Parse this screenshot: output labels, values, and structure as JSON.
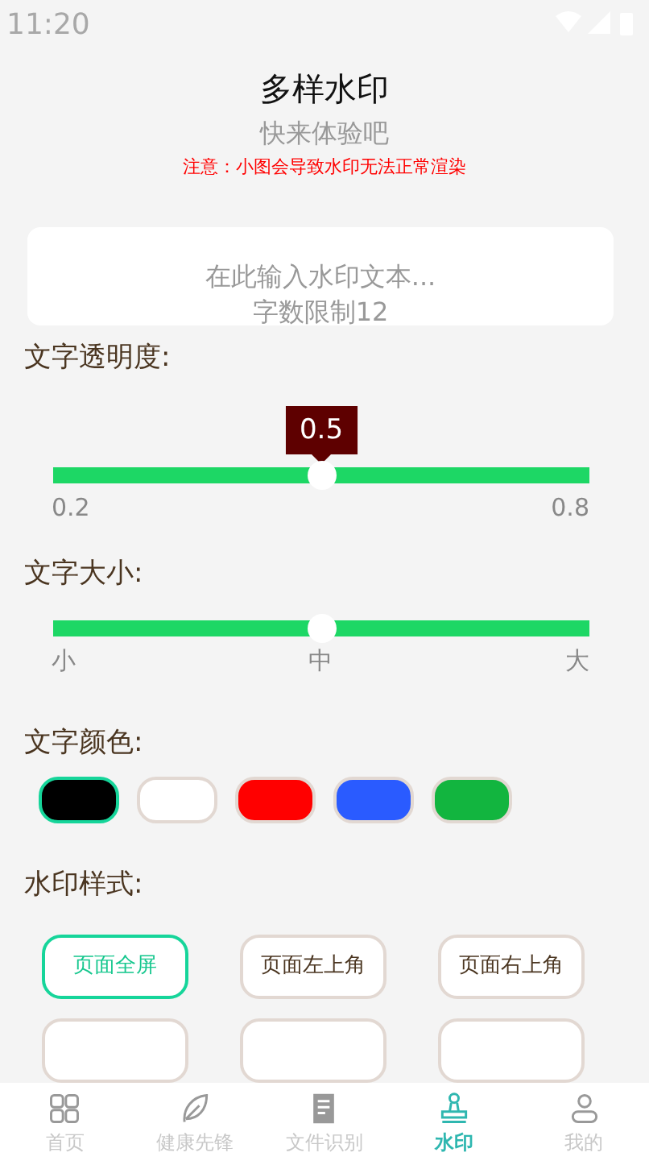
{
  "status_bar": {
    "time": "11:20"
  },
  "header": {
    "title": "多样水印",
    "subtitle": "快来体验吧",
    "notice": "注意：小图会导致水印无法正常渲染"
  },
  "text_input": {
    "placeholder": "在此输入水印文本...\n字数限制12"
  },
  "opacity": {
    "label": "文字透明度:",
    "tooltip": "0.5",
    "level": 0.5,
    "min_label": "0.2",
    "max_label": "0.8"
  },
  "size": {
    "label": "文字大小:",
    "level": 0.5,
    "ticks": [
      "小",
      "中",
      "大"
    ]
  },
  "colors": {
    "label": "文字颜色:",
    "items": [
      {
        "color": "#000000",
        "selected": true
      },
      {
        "color": "#ffffff",
        "selected": false
      },
      {
        "color": "#ff0000",
        "selected": false
      },
      {
        "color": "#2a5bff",
        "selected": false
      },
      {
        "color": "#12b53f",
        "selected": false
      }
    ]
  },
  "styles": {
    "label": "水印样式:",
    "items": [
      {
        "label": "页面全屏",
        "selected": true
      },
      {
        "label": "页面左上角",
        "selected": false
      },
      {
        "label": "页面右上角",
        "selected": false
      },
      {
        "selected": false
      },
      {
        "selected": false
      },
      {
        "selected": false
      }
    ]
  },
  "tab_bar": [
    {
      "label": "首页",
      "kind": "grid",
      "selected": false
    },
    {
      "label": "健康先锋",
      "kind": "leaf",
      "selected": false
    },
    {
      "label": "文件识别",
      "kind": "doc",
      "selected": false
    },
    {
      "label": "水印",
      "kind": "stamp",
      "selected": true
    },
    {
      "label": "我的",
      "kind": "user",
      "selected": false
    }
  ]
}
